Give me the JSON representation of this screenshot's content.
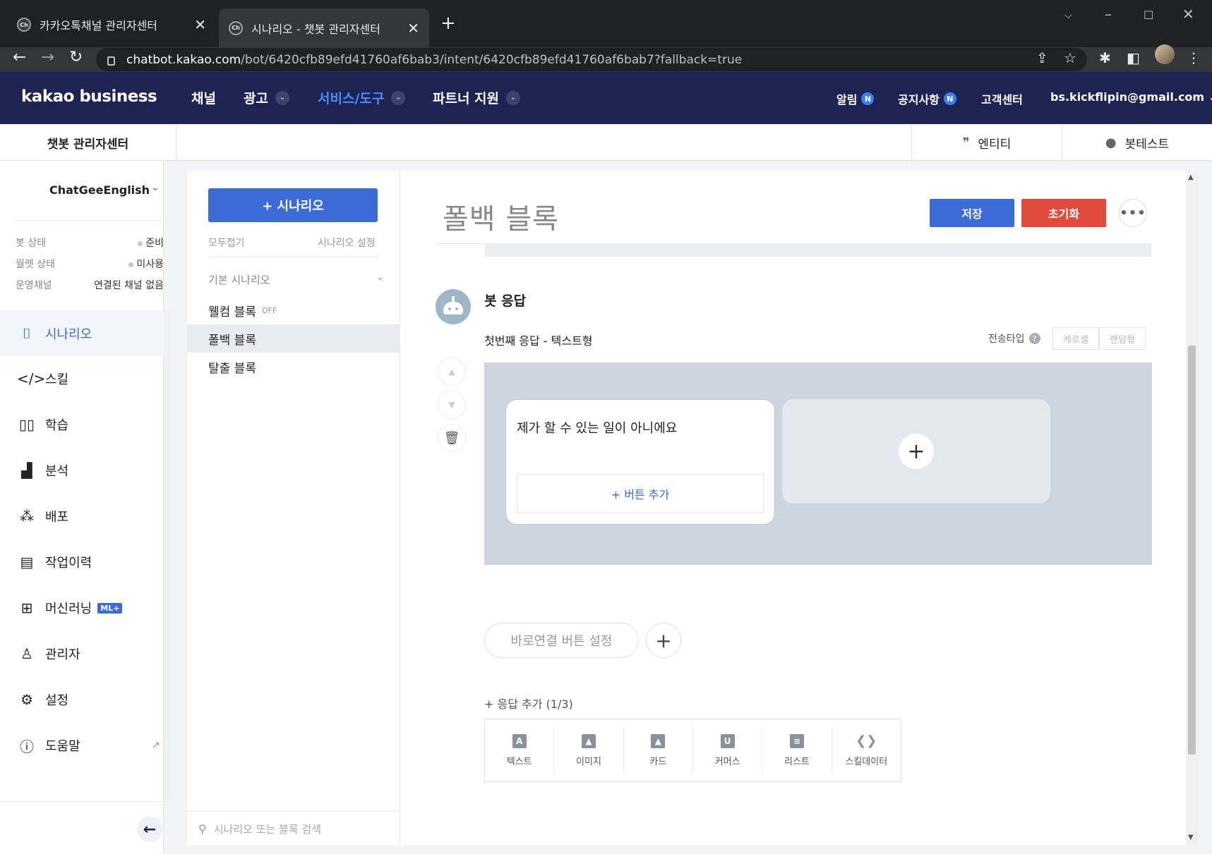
{
  "browser": {
    "tabs": [
      {
        "favicon": "Ch",
        "title": "카카오톡채널 관리자센터",
        "close": "✕"
      },
      {
        "favicon": "Ch",
        "title": "시나리오 - 챗봇 관리자센터",
        "close": "✕"
      }
    ],
    "new_tab": "+",
    "url_host": "chatbot.kakao.com",
    "url_path": "/bot/6420cfb89efd41760af6bab3/intent/6420cfb89efd41760af6bab7?fallback=true"
  },
  "header": {
    "logo": "kakao business",
    "menu": [
      {
        "label": "채널"
      },
      {
        "label": "광고"
      },
      {
        "label": "서비스/도구"
      },
      {
        "label": "파트너 지원"
      }
    ],
    "right": {
      "alerts": "알림",
      "notices": "공지사항",
      "badge": "N",
      "support": "고객센터",
      "account": "bs.kickflipin@gmail.com"
    }
  },
  "subheader": {
    "title": "챗봇 관리자센터",
    "entity": "엔티티",
    "bottest": "봇테스트"
  },
  "sidebar": {
    "bot_name": "ChatGeeEnglish",
    "status": [
      {
        "label": "봇 상태",
        "value": "준비"
      },
      {
        "label": "월렛 상태",
        "value": "미사용"
      },
      {
        "label": "운영채널",
        "value": "연결된 채널 없음"
      }
    ],
    "nav": [
      {
        "label": "시나리오",
        "icon": "scenario-icon"
      },
      {
        "label": "스킬",
        "icon": "code-icon"
      },
      {
        "label": "학습",
        "icon": "book-icon"
      },
      {
        "label": "분석",
        "icon": "chart-icon"
      },
      {
        "label": "배포",
        "icon": "deploy-icon"
      },
      {
        "label": "작업이력",
        "icon": "history-icon"
      },
      {
        "label": "머신러닝",
        "icon": "chip-icon",
        "badge": "ML+"
      },
      {
        "label": "관리자",
        "icon": "admin-icon"
      },
      {
        "label": "설정",
        "icon": "gear-icon"
      },
      {
        "label": "도움말",
        "icon": "help-icon"
      }
    ]
  },
  "scenarios": {
    "add_label": "+ 시나리오",
    "collapse_all": "모두접기",
    "settings": "시나리오 설정",
    "group": "기본 시나리오",
    "blocks": [
      {
        "label": "웰컴 블록",
        "tag": "OFF"
      },
      {
        "label": "폴백 블록",
        "tag": ""
      },
      {
        "label": "탈출 블록",
        "tag": ""
      }
    ],
    "search_placeholder": "시나리오 또는 블록 검색"
  },
  "main": {
    "block_title": "폴백 블록",
    "save": "저장",
    "reset": "초기화",
    "more": "•••",
    "bot_reply": "봇 응답",
    "response_label": "첫번째 응답 - 텍스트형",
    "send_type": "전송타입",
    "help": "?",
    "carousel": "케로셀",
    "random": "랜덤형",
    "bubble_text": "제가 할 수 있는 일이 아니에요",
    "add_button": "+ 버튼 추가",
    "quick_reply": "바로연결 버튼 설정",
    "add_response": "+ 응답 추가 (1/3)",
    "types": [
      {
        "label": "텍스트",
        "icon": "A"
      },
      {
        "label": "이미지",
        "icon": "▲"
      },
      {
        "label": "카드",
        "icon": "▲"
      },
      {
        "label": "커머스",
        "icon": "U"
      },
      {
        "label": "리스트",
        "icon": "≡"
      },
      {
        "label": "스킬데이터",
        "icon": "❮❯"
      }
    ]
  },
  "colors": {
    "header_bg": "#1d2454",
    "primary": "#3a6bd6",
    "danger": "#e14b3d"
  }
}
